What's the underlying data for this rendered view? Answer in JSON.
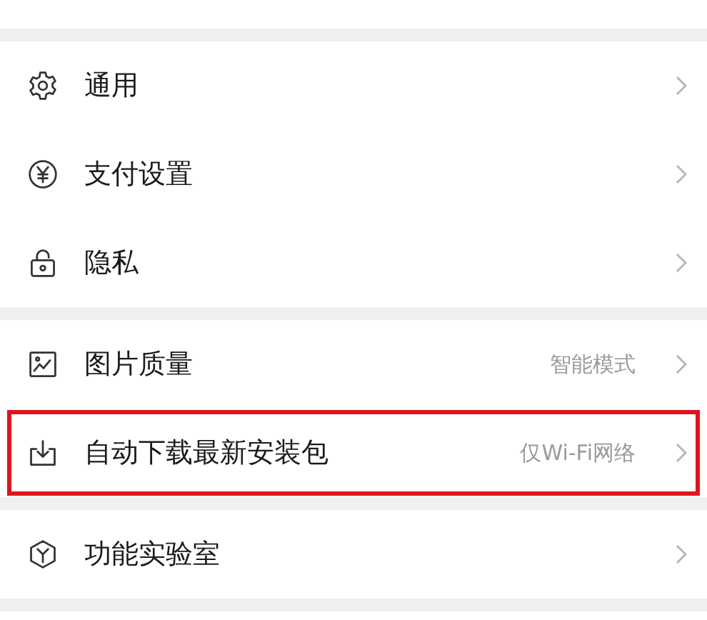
{
  "groups": [
    {
      "items": [
        {
          "kind": "gear",
          "label": "通用",
          "highlighted": false
        },
        {
          "kind": "yen",
          "label": "支付设置",
          "highlighted": false
        },
        {
          "kind": "lock",
          "label": "隐私",
          "highlighted": false
        }
      ]
    },
    {
      "items": [
        {
          "kind": "image",
          "label": "图片质量",
          "value": "智能模式",
          "highlighted": false
        },
        {
          "kind": "download",
          "label": "自动下载最新安装包",
          "value": "仅Wi-Fi网络",
          "highlighted": true
        }
      ]
    },
    {
      "items": [
        {
          "kind": "cube",
          "label": "功能实验室",
          "highlighted": false
        }
      ]
    }
  ]
}
